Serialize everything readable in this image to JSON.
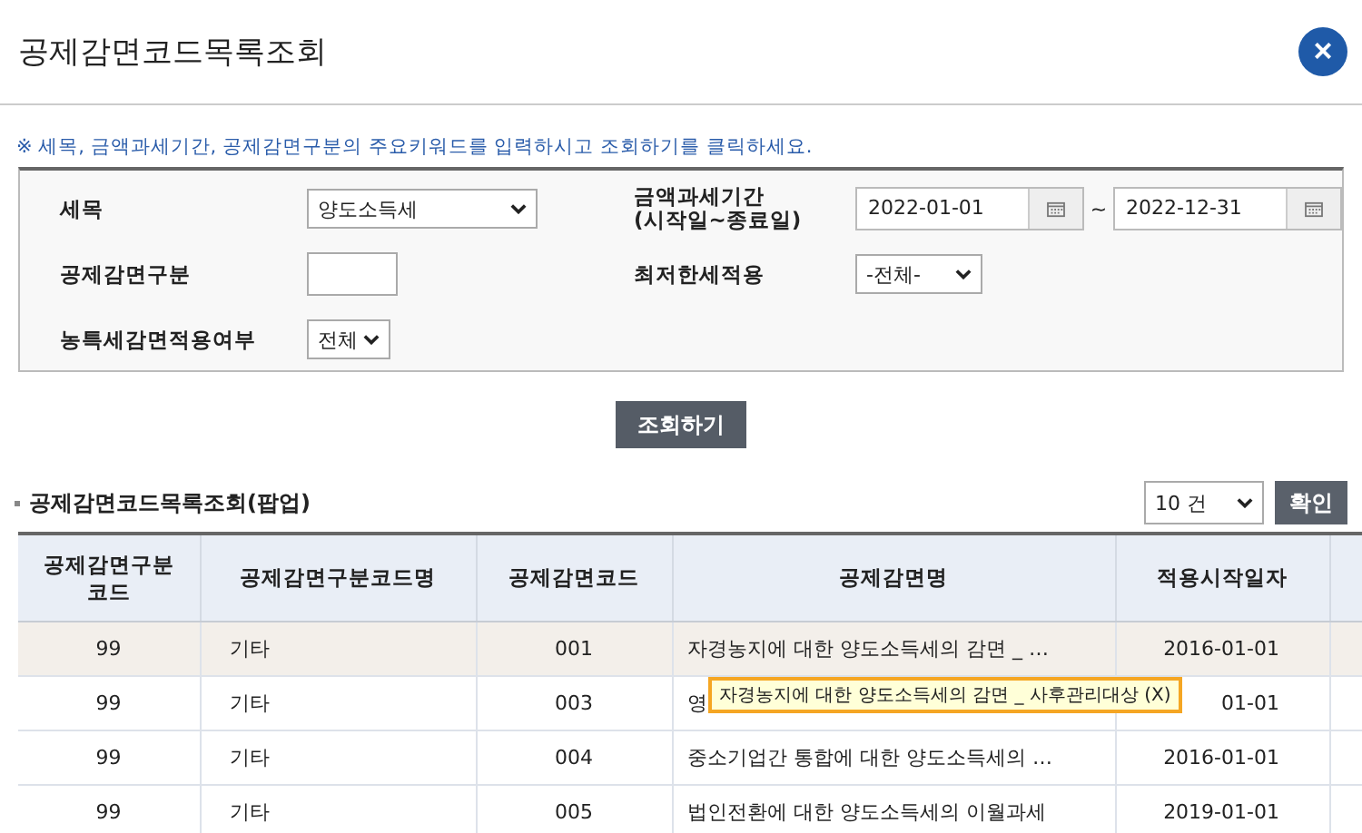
{
  "window": {
    "title": "공제감면코드목록조회",
    "close": "×"
  },
  "notice": "※ 세목, 금액과세기간, 공제감면구분의 주요키워드를 입력하시고 조회하기를 클릭하세요.",
  "form": {
    "tax_item": {
      "label": "세목",
      "value": "양도소득세"
    },
    "period": {
      "label": "금액과세기간",
      "sublabel": "(시작일~종료일)",
      "start": "2022-01-01",
      "separator": "~",
      "end": "2022-12-31"
    },
    "deduction_type": {
      "label": "공제감면구분"
    },
    "min_tax": {
      "label": "최저한세적용",
      "value": "-전체-"
    },
    "rural_tax": {
      "label": "농특세감면적용여부",
      "value": "전체"
    }
  },
  "search_button": "조회하기",
  "section": {
    "title": "공제감면코드목록조회(팝업)",
    "page_size": "10 건",
    "confirm_button": "확인"
  },
  "table": {
    "columns": [
      "공제감면구분코드",
      "공제감면구분코드명",
      "공제감면코드",
      "공제감면명",
      "적용시작일자"
    ],
    "rows": [
      {
        "cells": [
          "99",
          "기타",
          "001",
          "자경농지에 대한 양도소득세의 감면 _ …",
          "2016-01-01"
        ],
        "selected": true
      },
      {
        "cells": [
          "99",
          "기타",
          "003",
          "영",
          "01-01"
        ],
        "selected": false
      },
      {
        "cells": [
          "99",
          "기타",
          "004",
          "중소기업간 통합에 대한 양도소득세의 …",
          "2016-01-01"
        ],
        "selected": false
      },
      {
        "cells": [
          "99",
          "기타",
          "005",
          "법인전환에 대한 양도소득세의 이월과세",
          "2019-01-01"
        ],
        "selected": false
      }
    ]
  },
  "tooltip": "자경농지에 대한 양도소득세의 감면 _ 사후관리대상 (X)"
}
